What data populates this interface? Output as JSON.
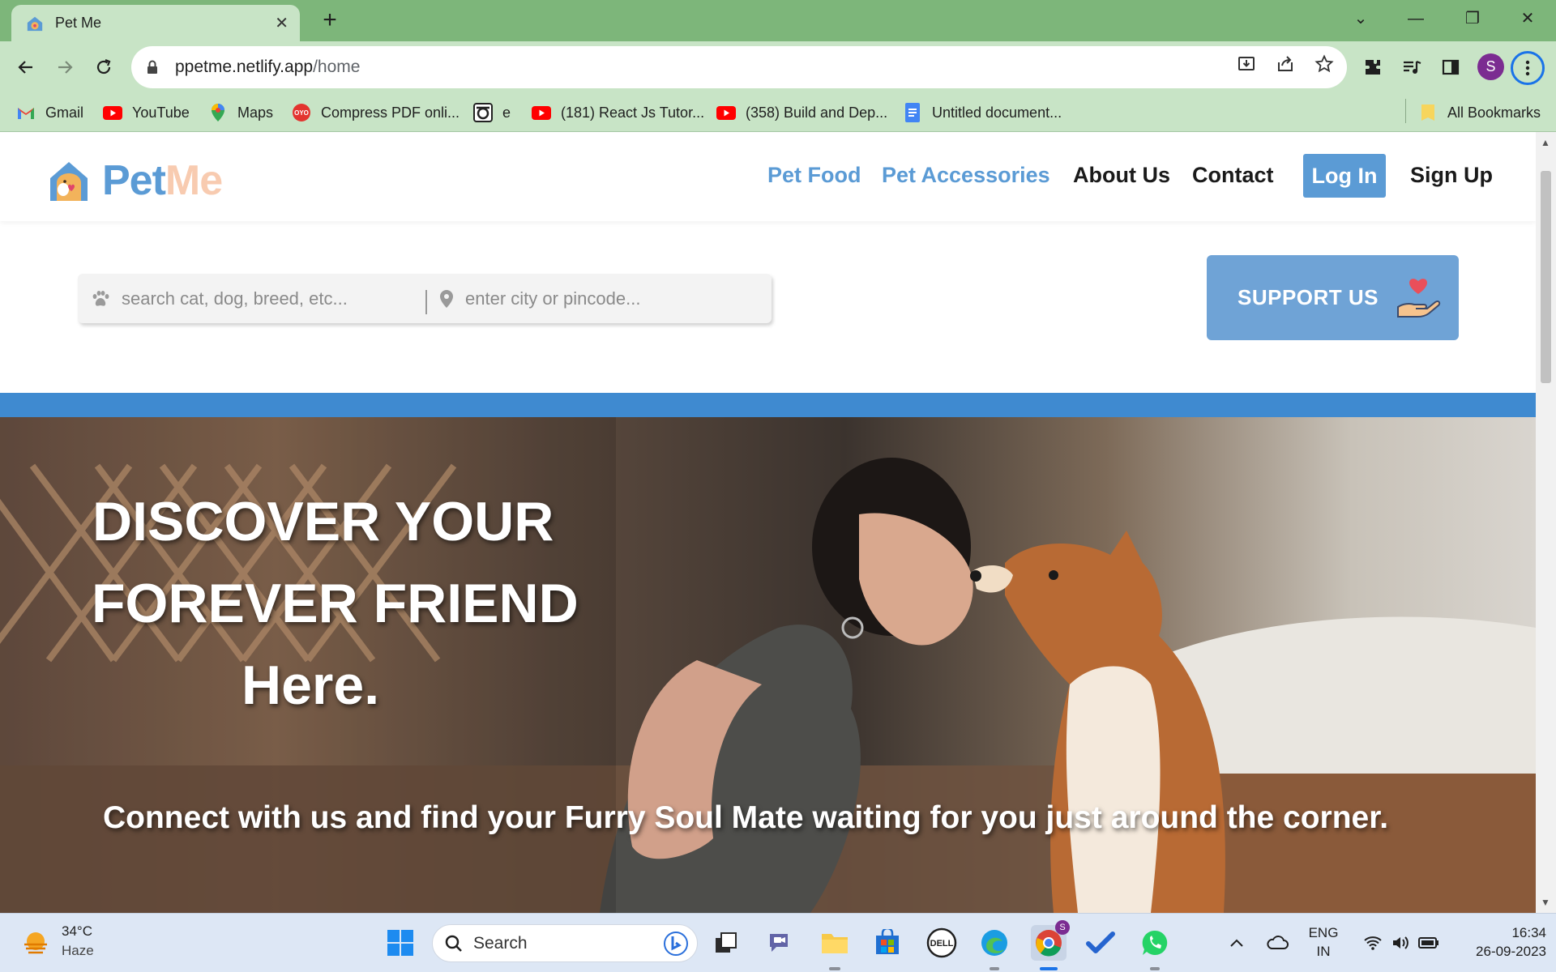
{
  "browser": {
    "tab_title": "Pet Me",
    "url_host": "ppetme.netlify.app",
    "url_path": "/home",
    "profile_initial": "S",
    "bookmarks": [
      {
        "label": "Gmail",
        "icon": "gmail-icon"
      },
      {
        "label": "YouTube",
        "icon": "youtube-icon"
      },
      {
        "label": "Maps",
        "icon": "maps-icon"
      },
      {
        "label": "Compress PDF onli...",
        "icon": "oyo-icon"
      },
      {
        "label": "e",
        "icon": "e-site-icon"
      },
      {
        "label": "(181) React Js Tutor...",
        "icon": "youtube-icon"
      },
      {
        "label": "(358) Build and Dep...",
        "icon": "youtube-icon"
      },
      {
        "label": "Untitled document...",
        "icon": "docs-icon"
      }
    ],
    "all_bookmarks": "All Bookmarks"
  },
  "site": {
    "logo_pet": "Pet",
    "logo_me": "Me",
    "nav": {
      "pet_food": "Pet Food",
      "pet_accessories": "Pet Accessories",
      "about_us": "About Us",
      "contact": "Contact",
      "log_in": "Log In",
      "sign_up": "Sign Up"
    },
    "search": {
      "pet_placeholder": "search cat, dog, breed, etc...",
      "location_placeholder": "enter city or pincode..."
    },
    "support_label": "SUPPORT US",
    "hero": {
      "line1": "DISCOVER YOUR",
      "line2": "FOREVER FRIEND",
      "line3": "Here.",
      "tagline": "Connect with us and find your Furry Soul Mate waiting for you just around the corner."
    }
  },
  "taskbar": {
    "weather_temp": "34°C",
    "weather_desc": "Haze",
    "search_label": "Search",
    "lang_line1": "ENG",
    "lang_line2": "IN",
    "time": "16:34",
    "date": "26-09-2023",
    "chrome_badge": "S"
  },
  "colors": {
    "brand_blue": "#5b9bd5",
    "brand_peach": "#f8cbb0",
    "band_blue": "#3f8ad0",
    "chrome_green": "#7db67a"
  }
}
